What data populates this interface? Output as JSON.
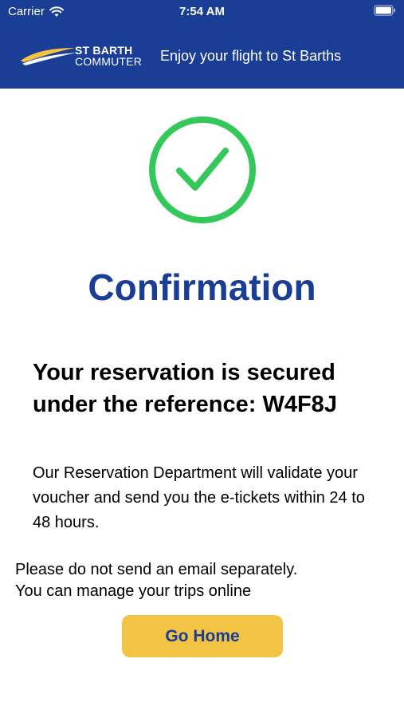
{
  "status_bar": {
    "carrier": "Carrier",
    "time": "7:54 AM",
    "icons": [
      "wifi-icon",
      "battery-icon"
    ]
  },
  "header": {
    "brand_line1": "ST BARTH",
    "brand_line2": "COMMUTER",
    "tagline": "Enjoy your flight to St Barths",
    "logo_icon": "plane-swoosh-logo"
  },
  "confirmation": {
    "icon": "check-circle-icon",
    "title": "Confirmation",
    "reservation_line1": "Your reservation is secured",
    "reservation_line2": "under the reference: W4F8J",
    "validate_text": "Our Reservation Department will validate your voucher and send you the e-tickets within 24 to 48 hours.",
    "notice_line1": "Please do not send an email separately.",
    "notice_line2": "You can manage your trips online",
    "go_home_label": "Go Home"
  },
  "colors": {
    "brand_blue": "#1a3d96",
    "check_green": "#34c759",
    "button_yellow": "#f3c443"
  }
}
